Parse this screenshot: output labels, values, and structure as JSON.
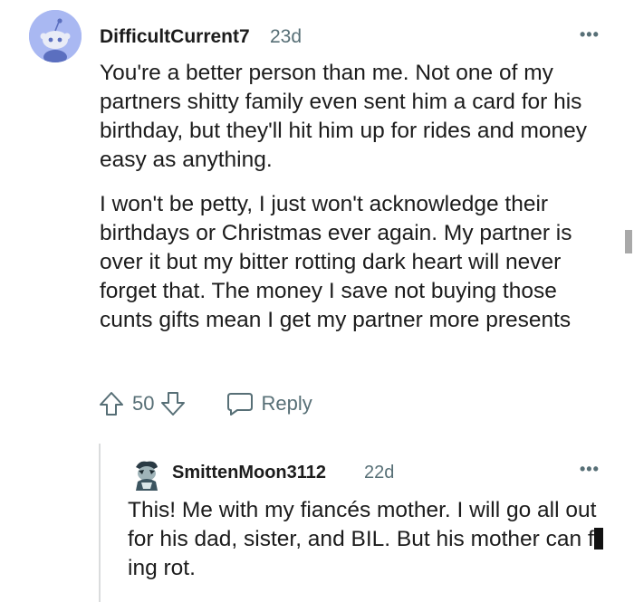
{
  "comment": {
    "username": "DifficultCurrent7",
    "age": "23d",
    "more": "•••",
    "paragraphs": [
      "You're a better person than me. Not one of my partners shitty family even sent him a card for his birthday, but they'll hit him up for rides and money easy as anything.",
      "I won't be petty, I just won't acknowledge their birthdays or Christmas ever again. My partner is over it but my bitter rotting dark heart will never forget that. The money I save not buying those cunts gifts mean I get my partner more presents"
    ],
    "vote_count": "50",
    "reply_label": "Reply",
    "icons": {
      "avatar": "reddit-snoo-avatar-icon",
      "upvote": "arrow-up-icon",
      "downvote": "arrow-down-icon",
      "reply": "speech-bubble-icon"
    }
  },
  "reply": {
    "username": "SmittenMoon3112",
    "age": "22d",
    "more": "•••",
    "text_before": "This! Me with my fiancés mother. I will go all out for his dad, sister, and BIL. But his mother can f",
    "text_after": "ing rot.",
    "icons": {
      "avatar": "user-avatar-icon"
    }
  },
  "colors": {
    "meta": "#576f76",
    "avatar_bg": "#a9b8f2",
    "text": "#1c1c1c"
  }
}
